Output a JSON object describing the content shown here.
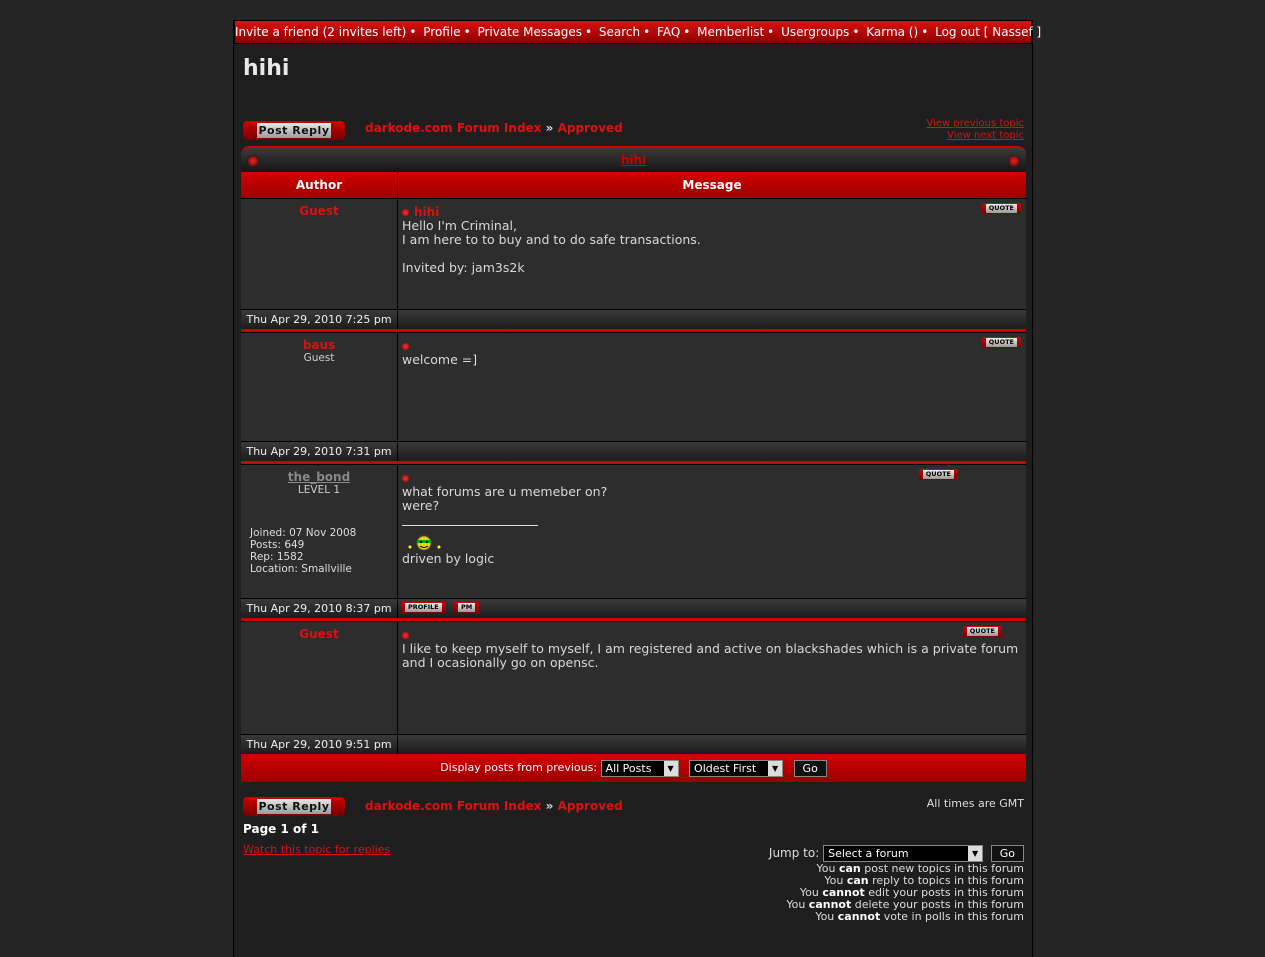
{
  "nav": {
    "items": [
      "Invite a friend (2 invites left)",
      "Profile",
      "Private Messages",
      "Search",
      "FAQ",
      "Memberlist",
      "Usergroups",
      "Karma ()",
      "Log out [ Nassef ]"
    ]
  },
  "topic": {
    "title": "hihi",
    "caption": "hihi"
  },
  "buttons": {
    "post_reply": "Post Reply",
    "go": "Go"
  },
  "breadcrumb": {
    "forum_index": "darkode.com Forum Index",
    "sep": "»",
    "category": "Approved"
  },
  "topic_nav": {
    "prev": "View previous topic",
    "next": "View next topic"
  },
  "table": {
    "author_header": "Author",
    "message_header": "Message"
  },
  "posts": [
    {
      "author": "Guest",
      "rank": "",
      "subject": "hihi",
      "lines": [
        "Hello I'm Criminal,",
        "I am here to to buy and to do safe transactions.",
        "",
        "Invited by: jam3s2k"
      ],
      "date": "Thu Apr 29, 2010 7:25 pm"
    },
    {
      "author": "baus",
      "rank": "Guest",
      "subject": "",
      "lines": [
        "welcome =]"
      ],
      "date": "Thu Apr 29, 2010 7:31 pm"
    },
    {
      "author": "the_bond",
      "rank": "LEVEL 1",
      "subject": "",
      "joined": "Joined: 07 Nov 2008",
      "posts": "Posts: 649",
      "rep": "Rep: 1582",
      "location": "Location: Smallville",
      "lines": [
        "what forums are u memeber on?",
        "were?"
      ],
      "signature": "driven by logic",
      "date": "Thu Apr 29, 2010 8:37 pm"
    },
    {
      "author": "Guest",
      "rank": "",
      "subject": "",
      "lines": [
        "I like to keep myself to myself, I am registered and active on blackshades which is a private forum",
        "and I ocasionally go on opensc."
      ],
      "date": "Thu Apr 29, 2010 9:51 pm"
    }
  ],
  "small_buttons": {
    "quote": "QUOTE",
    "profile": "PROFILE",
    "pm": "PM"
  },
  "display": {
    "label": "Display posts from previous:",
    "period": "All Posts",
    "order": "Oldest First"
  },
  "footer": {
    "timezone": "All times are GMT",
    "page": "Page 1 of 1",
    "watch": "Watch this topic for replies",
    "jump_label": "Jump to:",
    "jump_value": "Select a forum"
  },
  "permissions": [
    {
      "pre": "You ",
      "bold": "can",
      "post": " post new topics in this forum"
    },
    {
      "pre": "You ",
      "bold": "can",
      "post": " reply to topics in this forum"
    },
    {
      "pre": "You ",
      "bold": "cannot",
      "post": " edit your posts in this forum"
    },
    {
      "pre": "You ",
      "bold": "cannot",
      "post": " delete your posts in this forum"
    },
    {
      "pre": "You ",
      "bold": "cannot",
      "post": " vote in polls in this forum"
    }
  ]
}
